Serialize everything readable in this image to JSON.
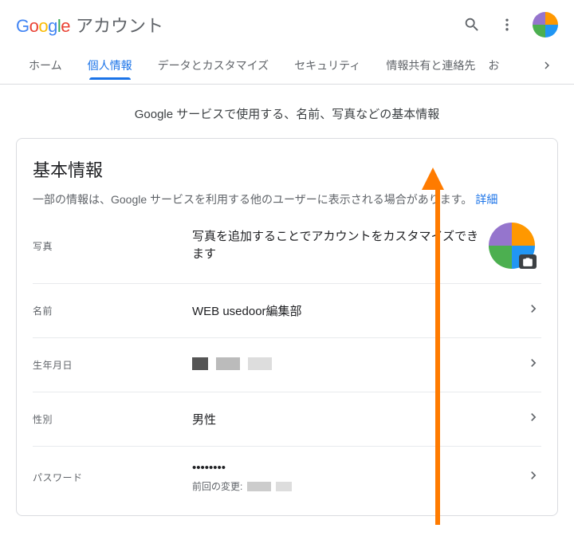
{
  "header": {
    "logo_account": "アカウント"
  },
  "tabs": {
    "items": [
      {
        "label": "ホーム"
      },
      {
        "label": "個人情報"
      },
      {
        "label": "データとカスタマイズ"
      },
      {
        "label": "セキュリティ"
      },
      {
        "label": "情報共有と連絡先"
      }
    ],
    "overflow": "お"
  },
  "subtitle": "Google サービスで使用する、名前、写真などの基本情報",
  "card": {
    "title": "基本情報",
    "desc": "一部の情報は、Google サービスを利用する他のユーザーに表示される場合があります。",
    "detail_link": "詳細"
  },
  "rows": {
    "photo": {
      "label": "写真",
      "value": "写真を追加することでアカウントをカスタマイズできます"
    },
    "name": {
      "label": "名前",
      "value": "WEB usedoor編集部"
    },
    "birthday": {
      "label": "生年月日"
    },
    "gender": {
      "label": "性別",
      "value": "男性"
    },
    "password": {
      "label": "パスワード",
      "value": "••••••••",
      "sub_prefix": "前回の変更:"
    }
  }
}
